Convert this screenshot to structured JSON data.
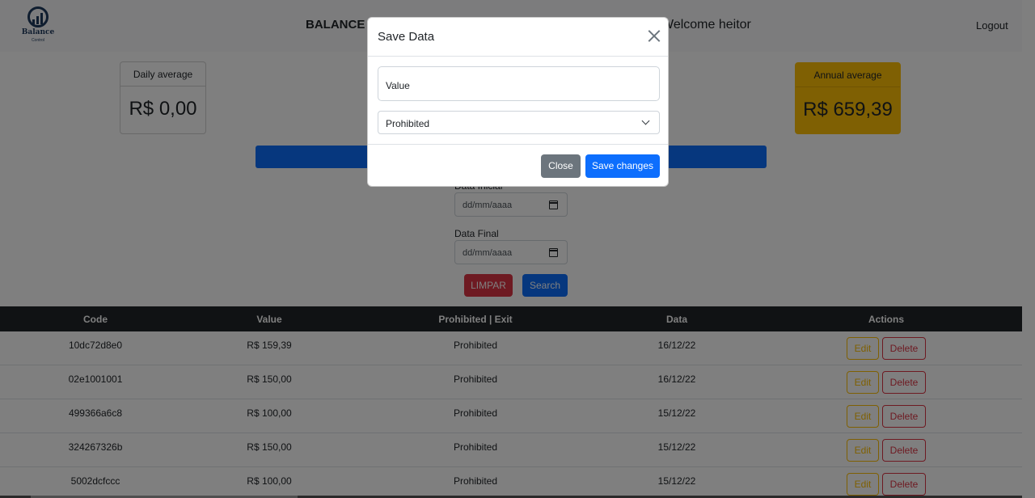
{
  "navbar": {
    "logo_text": "Balance",
    "logo_sub": "Control",
    "brand": "BALANCE CONTROL",
    "welcome": "Welcome heitor",
    "logout": "Logout"
  },
  "cards": {
    "daily": {
      "label": "Daily average",
      "value": "R$ 0,00"
    },
    "annual": {
      "label": "Annual average",
      "value": "R$ 659,39"
    }
  },
  "filters": {
    "initial_label": "Data Inicial",
    "initial_placeholder": "dd/mm/aaaa",
    "final_label": "Data Final",
    "final_placeholder": "dd/mm/aaaa",
    "clear_label": "LIMPAR",
    "search_label": "Search"
  },
  "table": {
    "headers": [
      "Code",
      "Value",
      "Prohibited | Exit",
      "Data",
      "Actions"
    ],
    "rows": [
      {
        "code": "10dc72d8e0",
        "value": "R$ 159,39",
        "type": "Prohibited",
        "date": "16/12/22"
      },
      {
        "code": "02e1001001",
        "value": "R$ 150,00",
        "type": "Prohibited",
        "date": "16/12/22"
      },
      {
        "code": "499366a6c8",
        "value": "R$ 100,00",
        "type": "Prohibited",
        "date": "15/12/22"
      },
      {
        "code": "324267326b",
        "value": "R$ 150,00",
        "type": "Prohibited",
        "date": "15/12/22"
      },
      {
        "code": "5002dcfccc",
        "value": "R$ 100,00",
        "type": "Prohibited",
        "date": "15/12/22"
      }
    ],
    "edit_label": "Edit",
    "delete_label": "Delete"
  },
  "modal": {
    "title": "Save Data",
    "value_placeholder": "Value",
    "select_value": "Prohibited",
    "close_label": "Close",
    "save_label": "Save changes"
  },
  "colors": {
    "primary": "#0d6efd",
    "danger": "#dc3545",
    "warning": "#ffc107",
    "dark": "#212529",
    "secondary": "#6c757d"
  }
}
